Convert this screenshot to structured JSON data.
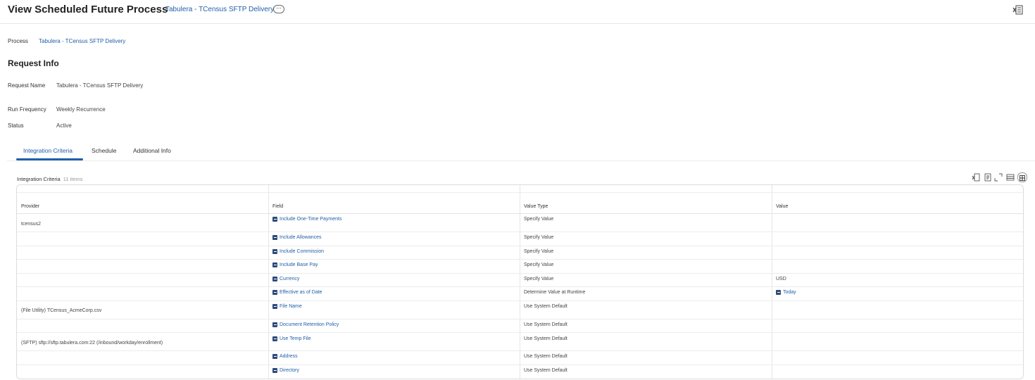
{
  "header": {
    "title": "View Scheduled Future Process",
    "subtitle": "Tabulera - TCensus SFTP Delivery",
    "more_label": "⋯"
  },
  "process": {
    "label": "Process",
    "value": "Tabulera - TCensus SFTP Delivery"
  },
  "request_info": {
    "title": "Request Info",
    "request_name_label": "Request Name",
    "request_name": "Tabulera - TCensus SFTP Delivery",
    "run_frequency_label": "Run Frequency",
    "run_frequency": "Weekly Recurrence",
    "status_label": "Status",
    "status": "Active"
  },
  "tabs": [
    {
      "label": "Integration Criteria",
      "active": true
    },
    {
      "label": "Schedule",
      "active": false
    },
    {
      "label": "Additional Info",
      "active": false
    }
  ],
  "grid": {
    "title": "Integration Criteria",
    "count": "11 items",
    "columns": [
      "Provider",
      "Field",
      "Value Type",
      "Value"
    ],
    "rows": [
      {
        "provider": "tcensus2",
        "field": "Include One-Time Payments",
        "value_type": "Specify Value",
        "value": ""
      },
      {
        "provider": "",
        "field": "Include Allowances",
        "value_type": "Specify Value",
        "value": ""
      },
      {
        "provider": "",
        "field": "Include Commission",
        "value_type": "Specify Value",
        "value": ""
      },
      {
        "provider": "",
        "field": "Include Base Pay",
        "value_type": "Specify Value",
        "value": ""
      },
      {
        "provider": "",
        "field": "Currency",
        "value_type": "Specify Value",
        "value": "USD"
      },
      {
        "provider": "",
        "field": "Effective as of Date",
        "value_type": "Determine Value at Runtime",
        "value": "Today"
      },
      {
        "provider": "(File Utility) TCensus_AcmeCorp.csv",
        "field": "File Name",
        "value_type": "Use System Default",
        "value": ""
      },
      {
        "provider": "",
        "field": "Document Retention Policy",
        "value_type": "Use System Default",
        "value": ""
      },
      {
        "provider": "(SFTP) sftp://sftp.tabulera.com:22 (/inbound/workday/enrollment)",
        "field": "Use Temp File",
        "value_type": "Use System Default",
        "value": ""
      },
      {
        "provider": "",
        "field": "Address",
        "value_type": "Use System Default",
        "value": ""
      },
      {
        "provider": "",
        "field": "Directory",
        "value_type": "Use System Default",
        "value": ""
      }
    ]
  },
  "colors": {
    "accent": "#1f5fa8",
    "field_icon": "#2e4a7d"
  }
}
